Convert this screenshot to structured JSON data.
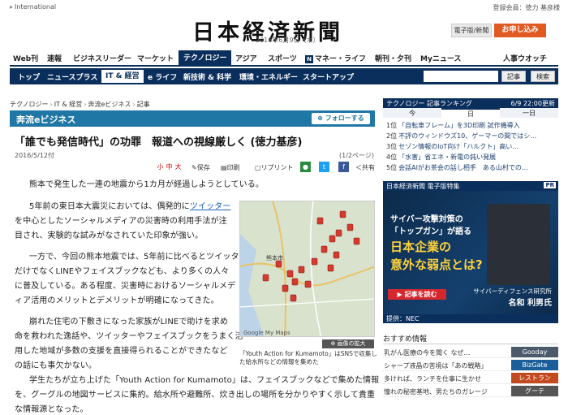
{
  "top": {
    "international": "International",
    "member": "登録会員：徳力 基彦様"
  },
  "masthead": {
    "logo": "日本経済新聞",
    "date": "2016年6月9日（木）",
    "digital_btn": "電子版/新聞",
    "apply_btn": "お申し込み"
  },
  "nav1": [
    "Web刊",
    "速報",
    "ビジネスリーダー",
    "マーケット",
    "テクノロジー",
    "アジア",
    "スポーツ",
    "マネー・ライフ",
    "朝刊・夕刊",
    "Myニュース",
    "人事ウオッチ"
  ],
  "nav1_n_mark": "N",
  "nav2": [
    "トップ",
    "ニュースプラス",
    "IT & 経営",
    "e ライフ",
    "新技術 & 科学",
    "環境・エネルギー",
    "スタートアップ"
  ],
  "nav2_buttons": {
    "kiji": "記事",
    "kensaku": "検索"
  },
  "breadcrumb": [
    "テクノロジー",
    "IT & 経営",
    "奔流eビジネス",
    "記事"
  ],
  "section": {
    "title": "奔流eビジネス",
    "follow": "フォローする"
  },
  "article": {
    "headline": "「誰でも発信時代」の功罪　報道への視線厳しく (徳力基彦)",
    "date": "2016/5/12付",
    "pages": "(1/2ページ)",
    "toolbar": {
      "fontsizes": [
        "小",
        "中",
        "大"
      ],
      "save": "保存",
      "print": "印刷",
      "reprint": "リプリント",
      "share": "共有"
    },
    "p1": "熊本で発生した一連の地震から1カ月が経過しようとしている。",
    "p2a": "5年前の東日本大震災においては、偶発的に",
    "p2link": "ツイッター",
    "p2b_l1": "を中心としたソーシャルメディアの災害時の利用手法が注",
    "p2b_l2": "目され、実験的な試みがなされていた印象が強い。",
    "p3_l1": "一方で、今回の熊本地震では、5年前に比べるとツイッター",
    "p3_l2": "だけでなくLINEやフェイスブックなども、より多くの人々",
    "p3_l3": "に普及している。ある程度、災害時におけるソーシャルメデ",
    "p3_l4": "ィア活用のメリットとデメリットが明確になってきた。",
    "p4_l1": "崩れた住宅の下敷きになった家族がLINEで助けを求め",
    "p4_l2": "命を救われた逸話や、ツイッターやフェイスブックをうまく活",
    "p4_l3": "用した地域が多数の支援を直接得られることができたなど",
    "p4_l4": "の話にも事欠かない。",
    "p5_l1": "学生たちが立ち上げた「Youth Action for Kumamoto」は、フェイスブックなどで集めた情報",
    "p5_l2": "を、グーグルの地図サービスに集約。給水所や避難所、炊き出しの場所を分かりやすく示して貴重",
    "p5_l3": "な情報源となった。",
    "map_caption": "「Youth Action for Kumamoto」はSNSで収集した給水所などの情報を集めた",
    "map_zoom": "画像の拡大",
    "map_labels": [
      "熊本市",
      "Google My Maps"
    ]
  },
  "ranking": {
    "title": "テクノロジー 記事ランキング",
    "time": "6/9 22:00更新",
    "tabs": [
      "今",
      "日",
      "一日"
    ],
    "rows": [
      {
        "n": "1位",
        "t": "「自転車フレーム」を3D印刷 試作機導入"
      },
      {
        "n": "2位",
        "t": "不評のウィンドウズ10、ゲーマーの間ではシ…"
      },
      {
        "n": "3位",
        "t": "セゾン情報のIoT向け「ハルクト」高い…"
      },
      {
        "n": "4位",
        "t": "「水害」省エネ・新電の鈍い発展"
      },
      {
        "n": "5位",
        "t": "会話AIがお茶会の話し相手　ある山村での…"
      }
    ]
  },
  "ad": {
    "header": "日本経済新聞 電子版特集",
    "pr": "PR",
    "line1": "サイバー攻撃対策の",
    "line2": "「トップガン」が語る",
    "line3": "日本企業の",
    "line4": "意外な弱点とは?",
    "read": "記事を読む",
    "who1": "サイバーディフェンス研究所",
    "who2": "名和 利男氏",
    "sponsor": "提供：NEC"
  },
  "recommend": {
    "title": "おすすめ情報",
    "rows": [
      {
        "t": "乳がん医療の今を聞く なぜ…",
        "tag": "Gooday",
        "color": "#4a5a6a"
      },
      {
        "t": "シャープ液晶の苦境は「あの戦略」",
        "tag": "BizGate",
        "color": "#1b5e9a"
      },
      {
        "t": "多ければ、ランチを仕事に生かせ",
        "tag": "レストラン",
        "color": "#c24a1e"
      },
      {
        "t": "憧れの秘密基地、男たちのガレージ",
        "tag": "グーテ",
        "color": "#555555"
      }
    ]
  }
}
